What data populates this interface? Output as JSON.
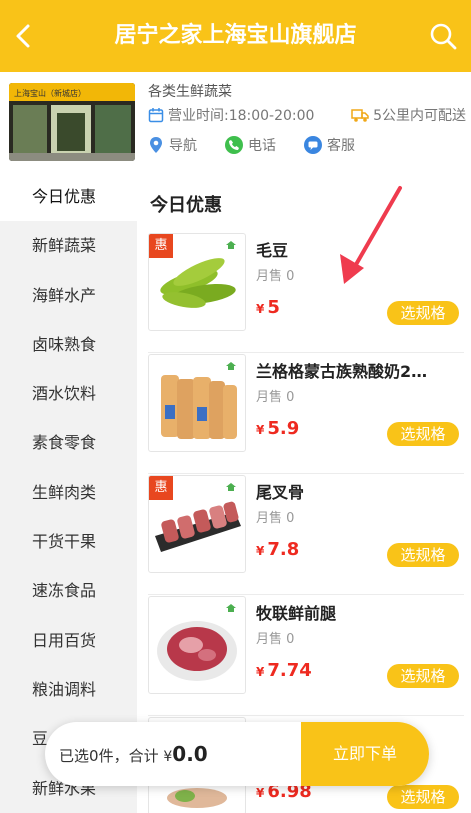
{
  "header": {
    "title": "居宁之家上海宝山旗舰店"
  },
  "store": {
    "category": "各类生鲜蔬菜",
    "hours": "营业时间:18:00-20:00",
    "delivery": "5公里内可配送",
    "sign_text": "上海宝山（新城店）",
    "actions": {
      "navigate": "导航",
      "phone": "电话",
      "service": "客服"
    }
  },
  "sidebar": {
    "items": [
      {
        "label": "今日优惠",
        "active": true
      },
      {
        "label": "新鲜蔬菜"
      },
      {
        "label": "海鲜水产"
      },
      {
        "label": "卤味熟食"
      },
      {
        "label": "酒水饮料"
      },
      {
        "label": "素食零食"
      },
      {
        "label": "生鲜肉类"
      },
      {
        "label": "干货干果"
      },
      {
        "label": "速冻食品"
      },
      {
        "label": "日用百货"
      },
      {
        "label": "粮油调料"
      },
      {
        "label": "豆"
      },
      {
        "label": "新鲜水果"
      }
    ]
  },
  "main": {
    "section_title": "今日优惠",
    "products": [
      {
        "name": "毛豆",
        "sold": "月售 0",
        "currency": "¥",
        "price": "5",
        "spec_label": "选规格",
        "badge": "惠"
      },
      {
        "name": "兰格格蒙古族熟酸奶2…",
        "sold": "月售 0",
        "currency": "¥",
        "price": "5.9",
        "spec_label": "选规格",
        "badge": ""
      },
      {
        "name": "尾叉骨",
        "sold": "月售 0",
        "currency": "¥",
        "price": "7.8",
        "spec_label": "选规格",
        "badge": "惠"
      },
      {
        "name": "牧联鲜前腿",
        "sold": "月售 0",
        "currency": "¥",
        "price": "7.74",
        "spec_label": "选规格",
        "badge": ""
      },
      {
        "name": "",
        "sold": "",
        "currency": "¥",
        "price": "6.98",
        "spec_label": "选规格",
        "badge": ""
      }
    ]
  },
  "cart": {
    "selected_prefix": "已选",
    "selected_count": "0",
    "selected_suffix": "件，合计",
    "currency": "¥",
    "total": "0.0",
    "order_label": "立即下单"
  },
  "colors": {
    "accent": "#f9c318",
    "price": "#ee2a20",
    "badge": "#e8471f"
  }
}
